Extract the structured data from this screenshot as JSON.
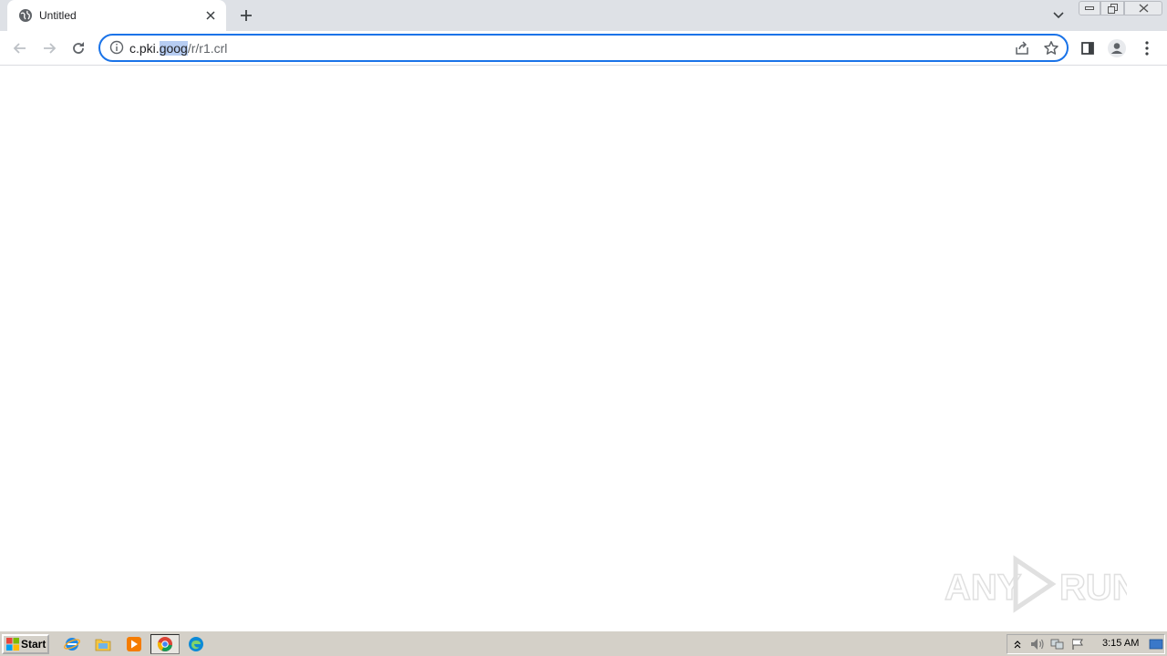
{
  "browser": {
    "tab": {
      "title": "Untitled",
      "favicon": "globe-icon"
    },
    "omnibox": {
      "url_host_prefix": "c.pki.",
      "url_host_selected": "goog",
      "url_path": "/r/r1.crl"
    },
    "accent_color": "#1a73e8"
  },
  "watermark": {
    "text": "ANY RUN"
  },
  "taskbar": {
    "start_label": "Start",
    "clock": "3:15 AM",
    "pinned": [
      "internet-explorer-icon",
      "file-explorer-icon",
      "media-player-icon",
      "chrome-icon",
      "edge-icon"
    ],
    "tray": [
      "show-hidden-icon",
      "volume-icon",
      "network-icon",
      "action-center-flag-icon",
      "show-desktop-icon"
    ]
  }
}
